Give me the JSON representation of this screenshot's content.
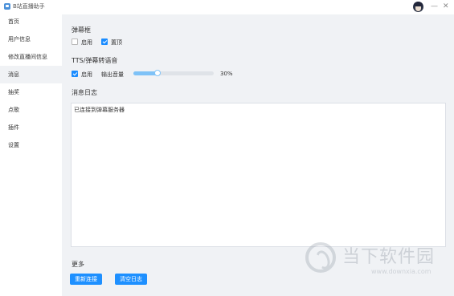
{
  "window": {
    "title": "B站直播助手",
    "min_glyph": "—",
    "close_glyph": "✕"
  },
  "sidebar": {
    "items": [
      {
        "label": "首页",
        "active": false
      },
      {
        "label": "用户信息",
        "active": false
      },
      {
        "label": "修改直播间信息",
        "active": false
      },
      {
        "label": "消息",
        "active": true
      },
      {
        "label": "抽奖",
        "active": false
      },
      {
        "label": "点歌",
        "active": false
      },
      {
        "label": "插件",
        "active": false
      },
      {
        "label": "设置",
        "active": false
      }
    ]
  },
  "danmaku_box": {
    "title": "弹幕框",
    "enable": {
      "label": "启用",
      "checked": false
    },
    "topmost": {
      "label": "置顶",
      "checked": true
    }
  },
  "tts": {
    "title": "TTS/弹幕转语音",
    "enable": {
      "label": "启用",
      "checked": true
    },
    "volume_label": "输出音量",
    "volume_value": 0.3,
    "volume_text": "30%"
  },
  "log": {
    "title": "消息日志",
    "lines": [
      "已连接到弹幕服务器"
    ]
  },
  "more": {
    "title": "更多",
    "reconnect_button": "重新连接",
    "clear_log_button": "清空日志"
  },
  "watermark": {
    "cn": "当下软件园",
    "en": "www.downxia.com"
  },
  "colors": {
    "accent": "#1e90ff",
    "slider": "#7ec2f7",
    "main_bg": "#f0f2f5"
  }
}
